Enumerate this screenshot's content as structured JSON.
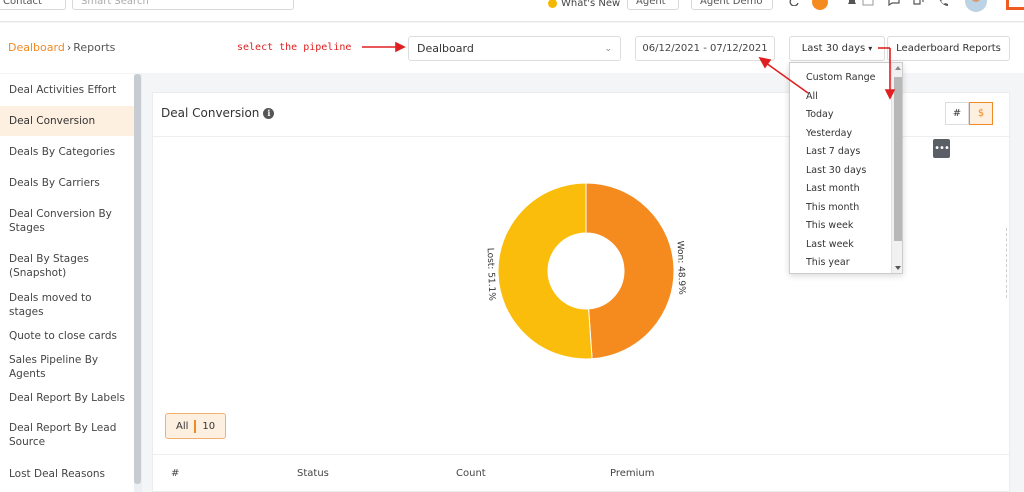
{
  "topbar": {
    "contact_label": "Contact",
    "search_placeholder": "Smart Search",
    "whats_new_label": "What's New",
    "agent_label": "Agent",
    "agent_demo_label": "Agent Demo"
  },
  "header": {
    "breadcrumb_parent": "Dealboard",
    "breadcrumb_current": "Reports",
    "annotation_text": "select the pipeline",
    "pipeline_value": "Dealboard",
    "date_range_value": "06/12/2021 - 07/12/2021",
    "period_label": "Last 30 days",
    "leaderboard_label": "Leaderboard Reports"
  },
  "sidebar": {
    "items": [
      "Deal Activities Effort",
      "Deal Conversion",
      "Deals By Categories",
      "Deals By Carriers",
      "Deal Conversion By Stages",
      "Deal By Stages (Snapshot)",
      "Deals moved to stages",
      "Quote to close cards",
      "Sales Pipeline By Agents",
      "Deal Report By Labels",
      "Deal Report By Lead Source",
      "Lost Deal Reasons"
    ],
    "active_index": 1
  },
  "card": {
    "title": "Deal Conversion",
    "toggle_hash": "#",
    "toggle_dollar": "$",
    "more_label": "•••",
    "filter_all": "All",
    "filter_count": "10",
    "table_headers": [
      "#",
      "Status",
      "Count",
      "Premium"
    ]
  },
  "dropdown": {
    "items": [
      "Custom Range",
      "All",
      "Today",
      "Yesterday",
      "Last 7 days",
      "Last 30 days",
      "Last month",
      "This month",
      "This week",
      "Last week",
      "This year"
    ]
  },
  "chart_data": {
    "type": "pie",
    "series": [
      {
        "name": "Won",
        "value": 48.9,
        "label": "Won: 48.9%",
        "color": "#f58b1f"
      },
      {
        "name": "Lost",
        "value": 51.1,
        "label": "Lost: 51.1%",
        "color": "#fbbd0c"
      }
    ],
    "donut": true
  },
  "colors": {
    "accent": "#f08a24",
    "annotation": "#e02020"
  }
}
